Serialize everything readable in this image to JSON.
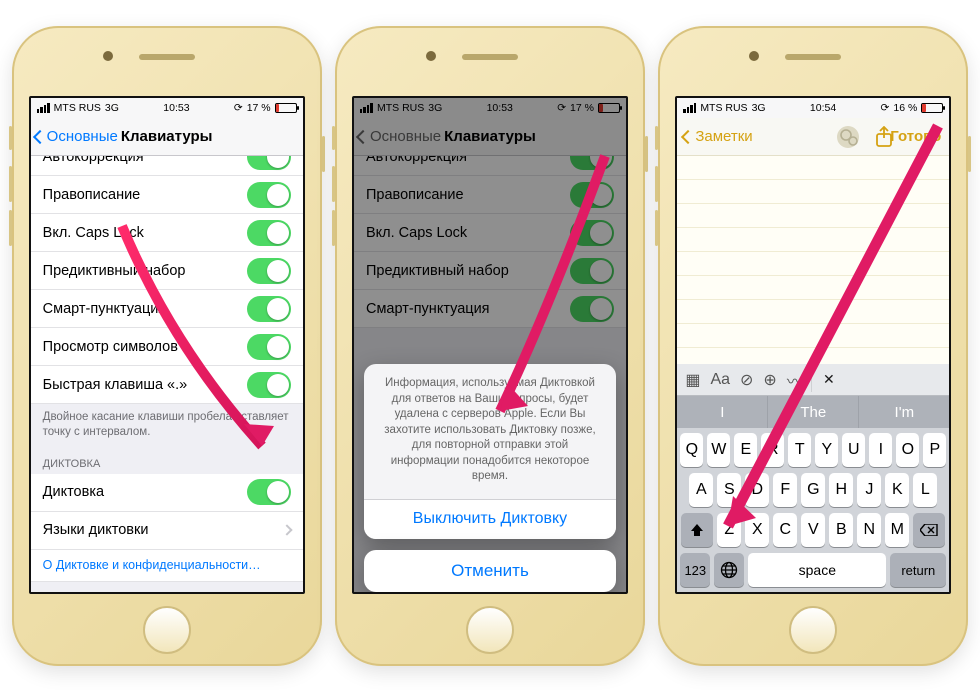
{
  "status": {
    "carrier": "MTS RUS",
    "net": "3G",
    "time1": "10:53",
    "time2": "10:53",
    "time3": "10:54",
    "batt1": "17 %",
    "batt2": "17 %",
    "batt3": "16 %"
  },
  "phone1": {
    "back": "Основные",
    "title": "Клавиатуры",
    "rows": {
      "r0": "Автокоррекция",
      "r1": "Правописание",
      "r2": "Вкл. Caps Lock",
      "r3": "Предиктивный набор",
      "r4": "Смарт-пунктуация",
      "r5": "Просмотр символов",
      "r6": "Быстрая клавиша «.»"
    },
    "foot": "Двойное касание клавиши пробела вставляет точку с интервалом.",
    "sec": "ДИКТОВКА",
    "dict": "Диктовка",
    "langs": "Языки диктовки",
    "privacy": "О Диктовке и конфиденциальности…"
  },
  "phone2": {
    "back": "Основные",
    "title": "Клавиатуры",
    "rows": {
      "r0": "Автокоррекция",
      "r1": "Правописание",
      "r2": "Вкл. Caps Lock",
      "r3": "Предиктивный набор",
      "r4": "Смарт-пунктуация"
    },
    "alert_msg": "Информация, используемая Диктовкой для ответов на Ваши запросы, будет удалена с серверов Apple. Если Вы захотите использовать Диктовку позже, для повторной отправки этой информации понадобится некоторое время.",
    "alert_btn": "Выключить Диктовку",
    "cancel": "Отменить"
  },
  "phone3": {
    "back": "Заметки",
    "done": "Готово",
    "pred": {
      "p1": "I",
      "p2": "The",
      "p3": "I'm"
    },
    "keys": {
      "row1": [
        "Q",
        "W",
        "E",
        "R",
        "T",
        "Y",
        "U",
        "I",
        "O",
        "P"
      ],
      "row2": [
        "A",
        "S",
        "D",
        "F",
        "G",
        "H",
        "J",
        "K",
        "L"
      ],
      "row3": [
        "Z",
        "X",
        "C",
        "V",
        "B",
        "N",
        "M"
      ]
    },
    "num": "123",
    "space": "space",
    "ret": "return",
    "fmt": {
      "aa": "Aa"
    }
  }
}
